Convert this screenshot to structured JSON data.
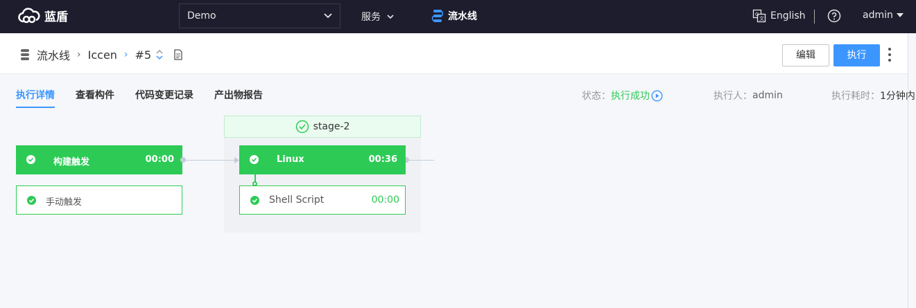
{
  "topbar": {
    "logo_text": "蓝盾",
    "project": "Demo",
    "service_label": "服务",
    "pipeline_label": "流水线",
    "language": "English",
    "user": "admin"
  },
  "header": {
    "crumb_root": "流水线",
    "crumb_pipeline": "Iccen",
    "crumb_build": "#5",
    "edit_label": "编辑",
    "run_label": "执行"
  },
  "tabs": [
    {
      "label": "执行详情",
      "active": true
    },
    {
      "label": "查看构件"
    },
    {
      "label": "代码变更记录"
    },
    {
      "label": "产出物报告"
    }
  ],
  "meta": {
    "status_label": "状态：",
    "status_value": "执行成功",
    "executor_label": "执行人：",
    "executor_value": "admin",
    "duration_label": "执行耗时：",
    "duration_value": "1分钟内"
  },
  "pipeline": {
    "stage1": {
      "job_name": "构建触发",
      "job_time": "00:00",
      "task_name": "手动触发"
    },
    "stage2": {
      "title": "stage-2",
      "job_name": "Linux",
      "job_time": "00:36",
      "task_name": "Shell Script",
      "task_time": "00:00"
    }
  },
  "colors": {
    "success": "#2dcb56",
    "primary": "#3c96ff",
    "topbar": "#1d1d2e"
  }
}
